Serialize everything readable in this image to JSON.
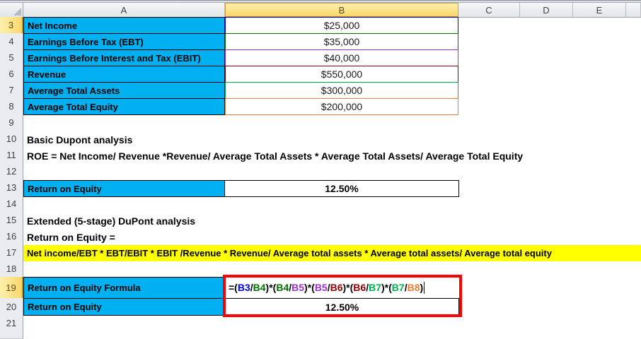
{
  "palette": {
    "cyan": "#00B0F0",
    "yellow": "#FFFF00",
    "red": "#FE0000",
    "black": "#000000",
    "blue": "#0000EE",
    "green": "#007000",
    "purple": "#9933CC",
    "maroon": "#8B0000",
    "bright_green": "#00B050",
    "orange": "#ED7D31"
  },
  "grid": {
    "columns": [
      {
        "letter": "A",
        "selected": false
      },
      {
        "letter": "B",
        "selected": true
      },
      {
        "letter": "C",
        "selected": false
      },
      {
        "letter": "D",
        "selected": false
      },
      {
        "letter": "E",
        "selected": false
      }
    ],
    "rows": [
      {
        "n": "3",
        "selected": true
      },
      {
        "n": "4",
        "selected": false
      },
      {
        "n": "5",
        "selected": false
      },
      {
        "n": "6",
        "selected": false
      },
      {
        "n": "7",
        "selected": false
      },
      {
        "n": "8",
        "selected": false
      },
      {
        "n": "9",
        "selected": false
      },
      {
        "n": "10",
        "selected": false
      },
      {
        "n": "11",
        "selected": false
      },
      {
        "n": "12",
        "selected": false
      },
      {
        "n": "13",
        "selected": false
      },
      {
        "n": "14",
        "selected": false
      },
      {
        "n": "15",
        "selected": false
      },
      {
        "n": "16",
        "selected": false
      },
      {
        "n": "17",
        "selected": false
      },
      {
        "n": "18",
        "selected": false
      },
      {
        "n": "19",
        "selected": true
      },
      {
        "n": "20",
        "selected": false
      },
      {
        "n": "21",
        "selected": false
      }
    ]
  },
  "input_table": {
    "rows": [
      {
        "row": 3,
        "label": "Net Income",
        "value": "$25,000",
        "ref_color": "blue"
      },
      {
        "row": 4,
        "label": "Earnings Before Tax (EBT)",
        "value": "$35,000",
        "ref_color": "green"
      },
      {
        "row": 5,
        "label": "Earnings Before Interest and Tax (EBIT)",
        "value": "$40,000",
        "ref_color": "purple"
      },
      {
        "row": 6,
        "label": "Revenue",
        "value": "$550,000",
        "ref_color": "maroon"
      },
      {
        "row": 7,
        "label": "Average Total Assets",
        "value": "$300,000",
        "ref_color": "bright_green"
      },
      {
        "row": 8,
        "label": "Average Total Equity",
        "value": "$200,000",
        "ref_color": "orange"
      }
    ]
  },
  "basic_section": {
    "title": "Basic Dupont analysis",
    "formula_text": "ROE = Net Income/ Revenue *Revenue/ Average Total Assets * Average Total Assets/ Average Total Equity",
    "result_label": "Return on Equity",
    "result_value": "12.50%"
  },
  "extended_section": {
    "title": "Extended (5-stage) DuPont analysis",
    "subtitle": "Return on Equity =",
    "highlight_text": "Net income/EBT * EBT/EBIT * EBIT /Revenue * Revenue/ Average total assets * Average total assets/ Average total equity",
    "formula_label": "Return on Equity Formula",
    "formula_segments": [
      {
        "t": "=(",
        "c": "black"
      },
      {
        "t": "B3",
        "c": "blue"
      },
      {
        "t": "/",
        "c": "black"
      },
      {
        "t": "B4",
        "c": "green"
      },
      {
        "t": ")*(",
        "c": "black"
      },
      {
        "t": "B4",
        "c": "green"
      },
      {
        "t": "/",
        "c": "black"
      },
      {
        "t": "B5",
        "c": "purple"
      },
      {
        "t": ")*(",
        "c": "black"
      },
      {
        "t": "B5",
        "c": "purple"
      },
      {
        "t": "/",
        "c": "black"
      },
      {
        "t": "B6",
        "c": "maroon"
      },
      {
        "t": ")*(",
        "c": "black"
      },
      {
        "t": "B6",
        "c": "maroon"
      },
      {
        "t": "/",
        "c": "black"
      },
      {
        "t": "B7",
        "c": "bright_green"
      },
      {
        "t": ")*(",
        "c": "black"
      },
      {
        "t": "B7",
        "c": "bright_green"
      },
      {
        "t": "/",
        "c": "black"
      },
      {
        "t": "B8",
        "c": "orange"
      },
      {
        "t": ")",
        "c": "black"
      }
    ],
    "result_label": "Return on Equity",
    "result_value": "12.50%"
  }
}
